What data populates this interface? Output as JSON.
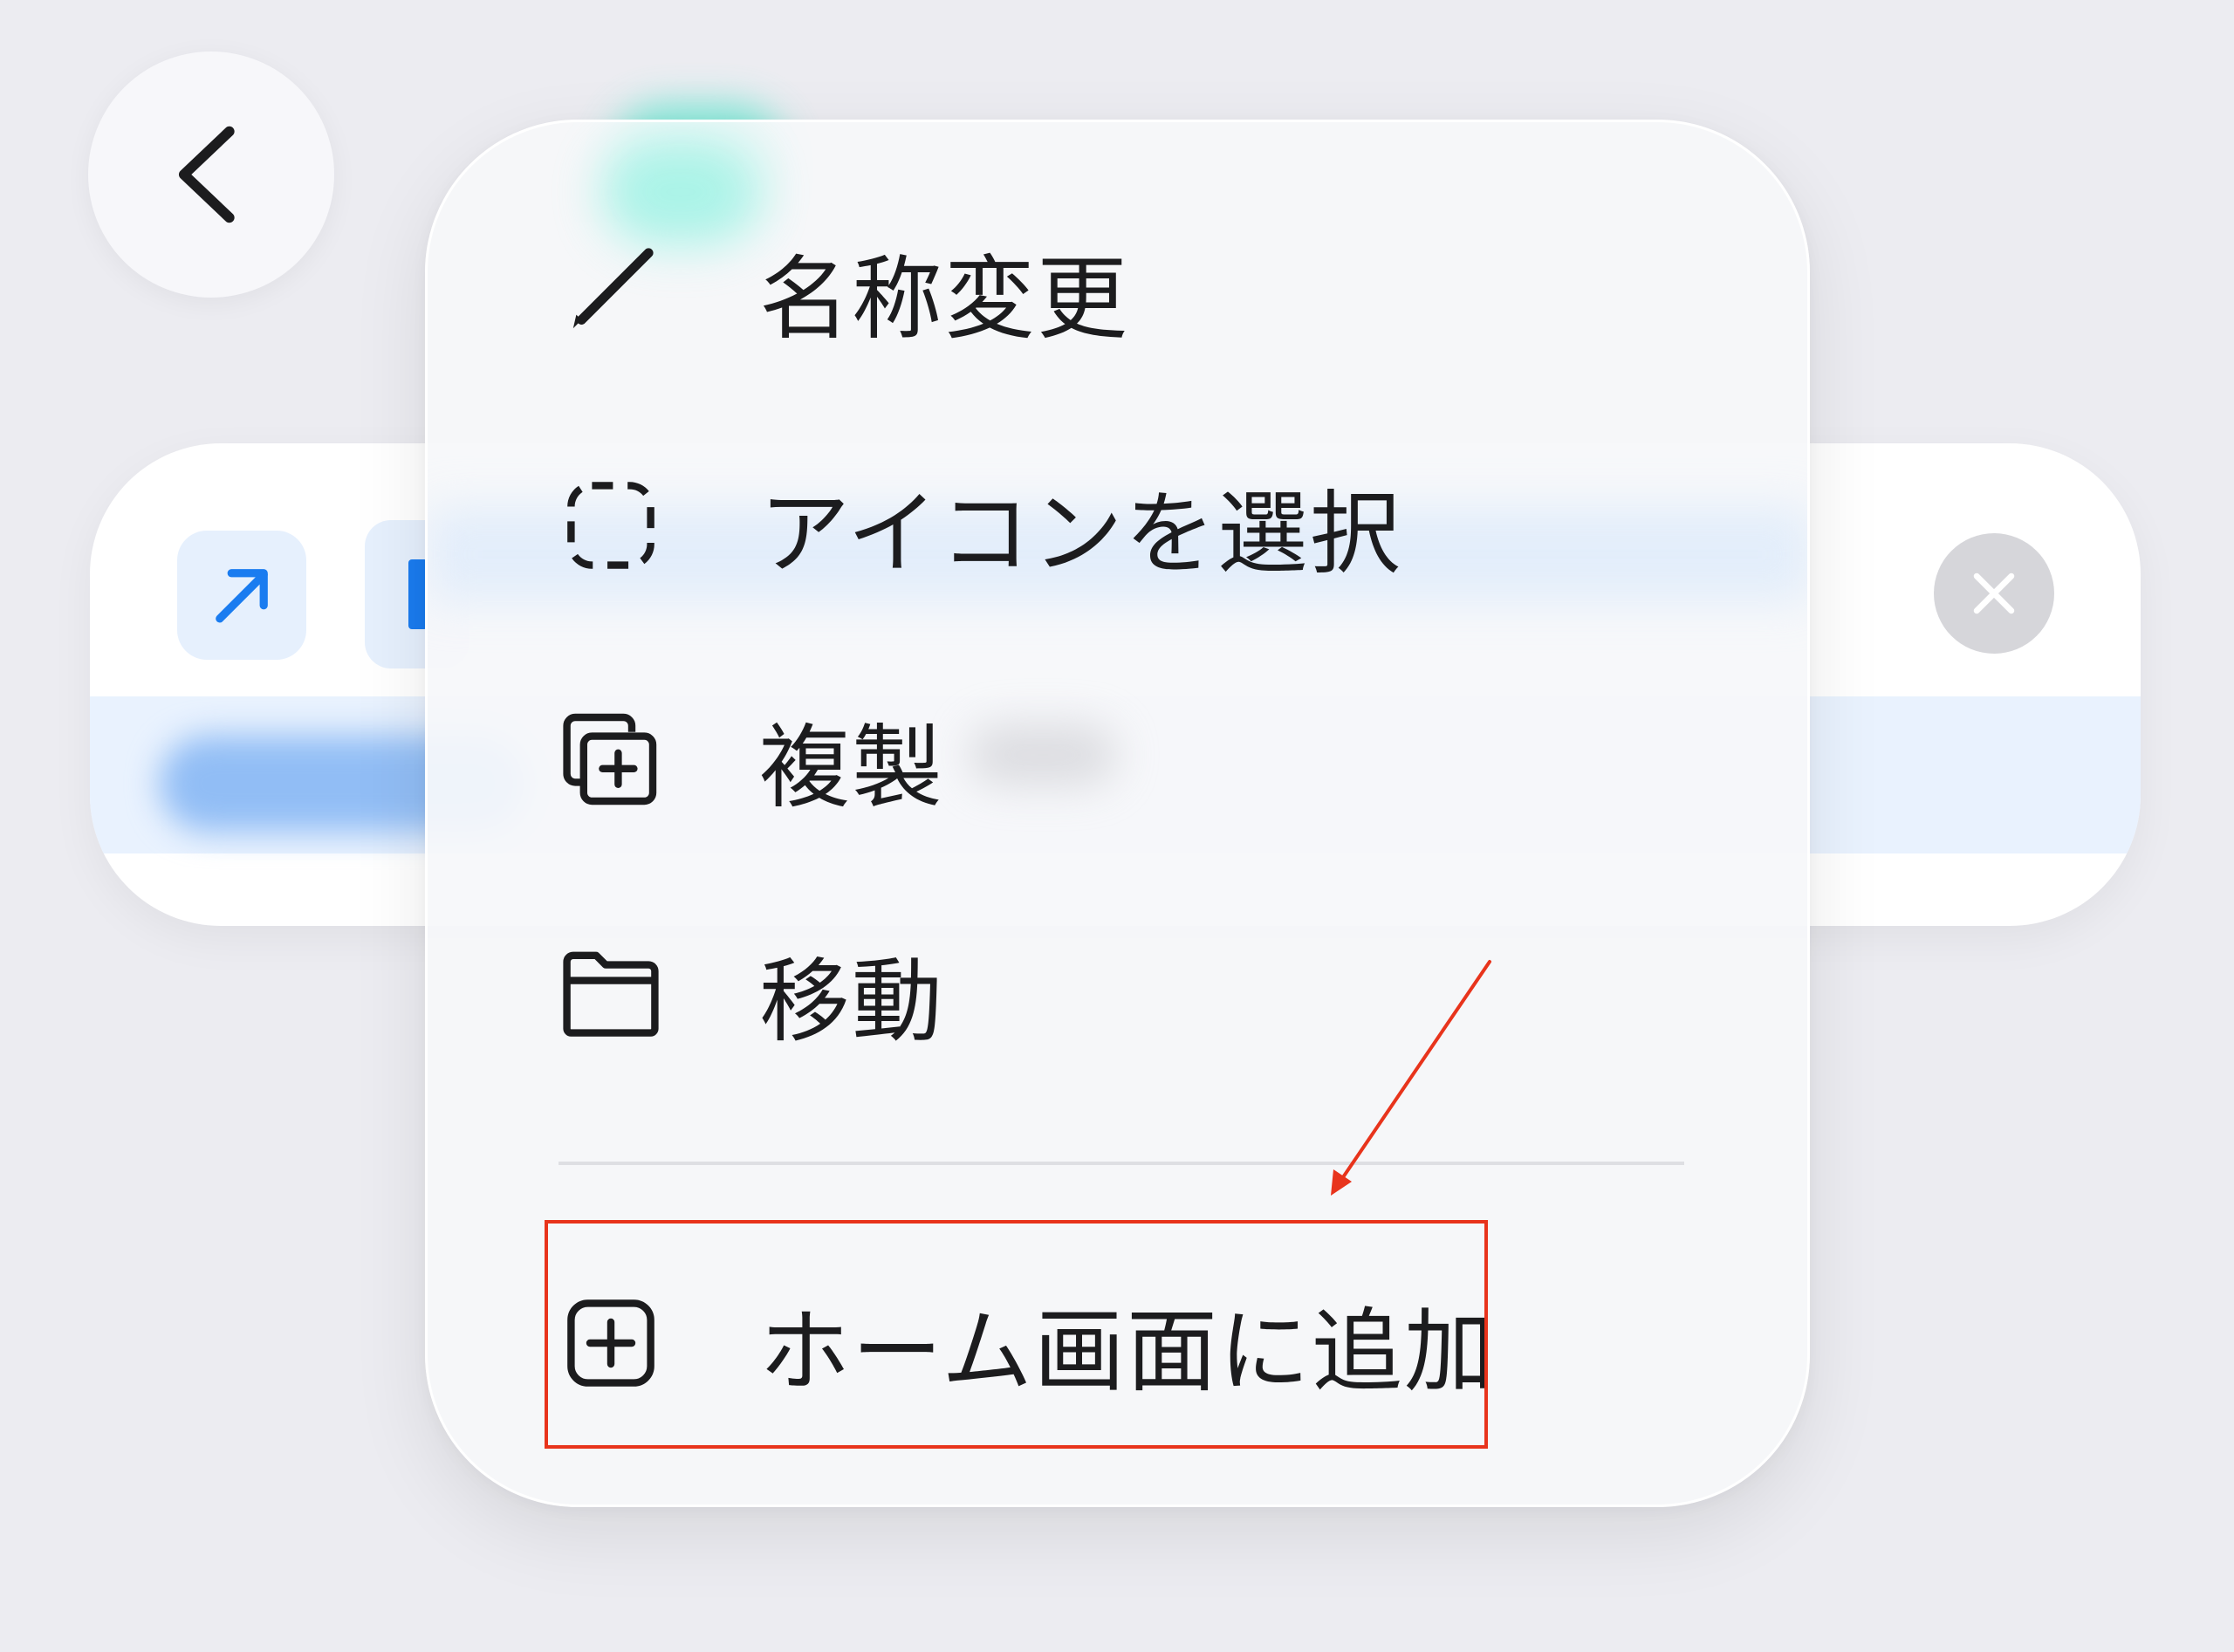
{
  "navigation": {
    "back_icon": "chevron-left-icon"
  },
  "background_row": {
    "leading_icon": "arrow-up-right-icon",
    "clear_icon": "close-icon"
  },
  "context_menu": {
    "items": [
      {
        "label": "名称変更",
        "icon": "pencil-icon"
      },
      {
        "label": "アイコンを選択",
        "icon": "dashed-square-icon"
      },
      {
        "label": "複製",
        "icon": "duplicate-icon"
      },
      {
        "label": "移動",
        "icon": "folder-icon"
      },
      {
        "label": "ホーム画面に追加",
        "icon": "plus-square-icon"
      }
    ]
  },
  "annotation": {
    "highlight_color": "#e8341c"
  },
  "colors": {
    "accent": "#1a7cf0",
    "text": "#1c1c1e",
    "background": "#ececf1"
  }
}
